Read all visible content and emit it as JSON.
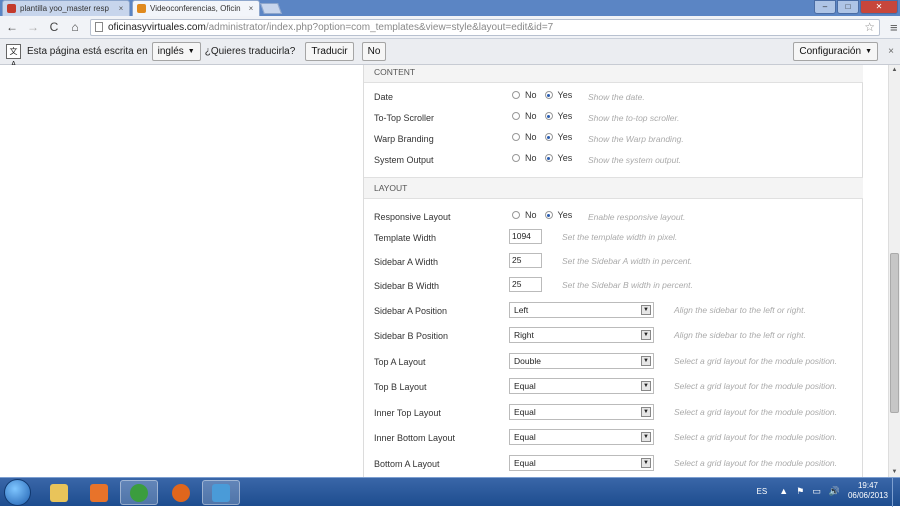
{
  "browser": {
    "tabs": [
      {
        "title": "plantilla yoo_master resp",
        "close": "×",
        "active": false,
        "favicon_color": "#c33a2c"
      },
      {
        "title": "Videoconferencias, Oficin",
        "close": "×",
        "active": true,
        "favicon_color": "#e08a1e"
      }
    ],
    "window_controls": {
      "minimize": "–",
      "maximize": "□",
      "close": "✕"
    },
    "toolbar": {
      "back": "←",
      "forward": "→",
      "reload": "C",
      "home": "⌂",
      "url_host": "oficinasyvirtuales.com",
      "url_path": "/administrator/index.php?option=com_templates&view=style&layout=edit&id=7",
      "star": "☆",
      "menu": "≡"
    },
    "translate_bar": {
      "icon_text": "文A",
      "message": "Esta página está escrita en",
      "language": "inglés",
      "question": "¿Quieres traducirla?",
      "translate_button": "Traducir",
      "no_button": "No",
      "config_button": "Configuración",
      "close": "×"
    }
  },
  "content_section": {
    "header": "CONTENT",
    "rows": [
      {
        "label": "Date",
        "no": "No",
        "yes": "Yes",
        "selected": "yes",
        "hint": "Show the date."
      },
      {
        "label": "To-Top Scroller",
        "no": "No",
        "yes": "Yes",
        "selected": "yes",
        "hint": "Show the to-top scroller."
      },
      {
        "label": "Warp Branding",
        "no": "No",
        "yes": "Yes",
        "selected": "yes",
        "hint": "Show the Warp branding."
      },
      {
        "label": "System Output",
        "no": "No",
        "yes": "Yes",
        "selected": "yes",
        "hint": "Show the system output."
      }
    ]
  },
  "layout_section": {
    "header": "LAYOUT",
    "responsive": {
      "label": "Responsive Layout",
      "no": "No",
      "yes": "Yes",
      "selected": "yes",
      "hint": "Enable responsive layout."
    },
    "template_width": {
      "label": "Template Width",
      "value": "1094",
      "hint": "Set the template width in pixel."
    },
    "sidebar_a_width": {
      "label": "Sidebar A Width",
      "value": "25",
      "hint": "Set the Sidebar A width in percent."
    },
    "sidebar_b_width": {
      "label": "Sidebar B Width",
      "value": "25",
      "hint": "Set the Sidebar B width in percent."
    },
    "selects": [
      {
        "label": "Sidebar A Position",
        "value": "Left",
        "hint": "Align the sidebar to the left or right."
      },
      {
        "label": "Sidebar B Position",
        "value": "Right",
        "hint": "Align the sidebar to the left or right."
      },
      {
        "label": "Top A Layout",
        "value": "Double",
        "hint": "Select a grid layout for the module position."
      },
      {
        "label": "Top B Layout",
        "value": "Equal",
        "hint": "Select a grid layout for the module position."
      },
      {
        "label": "Inner Top Layout",
        "value": "Equal",
        "hint": "Select a grid layout for the module position."
      },
      {
        "label": "Inner Bottom Layout",
        "value": "Equal",
        "hint": "Select a grid layout for the module position."
      },
      {
        "label": "Bottom A Layout",
        "value": "Equal",
        "hint": "Select a grid layout for the module position."
      }
    ],
    "select_arrow": "▼"
  },
  "scrollbar": {
    "up": "▲",
    "down": "▼"
  },
  "taskbar": {
    "apps": [
      {
        "name": "explorer",
        "color": "#e9c45a"
      },
      {
        "name": "media-player",
        "color": "#e8732a"
      },
      {
        "name": "chrome",
        "color": "#3b9d3e"
      },
      {
        "name": "firefox",
        "color": "#e0661c"
      },
      {
        "name": "app",
        "color": "#4a9bd8"
      }
    ],
    "language": "ES",
    "tray_icons": [
      "▲",
      "⚑",
      "▭",
      "🔊"
    ],
    "time": "19:47",
    "date": "06/06/2013"
  }
}
